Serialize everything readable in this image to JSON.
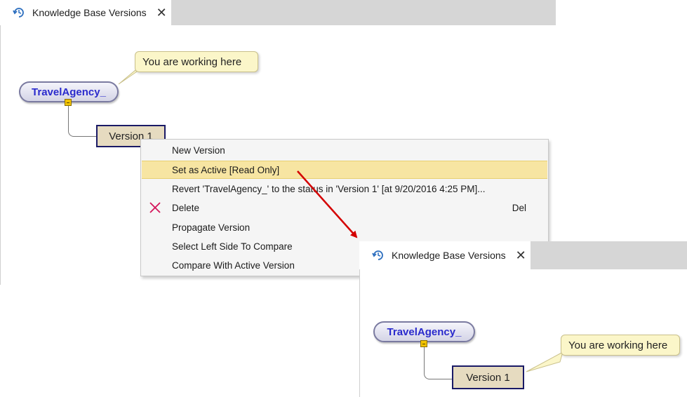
{
  "panel1": {
    "tab_title": "Knowledge Base Versions",
    "tab_close": "✕",
    "root_node": "TravelAgency_",
    "version_node": "Version 1",
    "bubble": "You are working here"
  },
  "context_menu": {
    "items": [
      {
        "label": "New Version",
        "shortcut": ""
      },
      {
        "label": "Set as Active [Read Only]",
        "shortcut": ""
      },
      {
        "label": "Revert 'TravelAgency_' to the status in 'Version 1' [at 9/20/2016 4:25 PM]...",
        "shortcut": ""
      },
      {
        "label": "Delete",
        "shortcut": "Del"
      },
      {
        "label": "Propagate Version",
        "shortcut": ""
      },
      {
        "label": "Select Left Side To Compare",
        "shortcut": ""
      },
      {
        "label": "Compare With Active Version",
        "shortcut": ""
      }
    ],
    "highlighted_index": 1
  },
  "panel2": {
    "tab_title": "Knowledge Base Versions",
    "tab_close": "✕",
    "root_node": "TravelAgency_",
    "version_node": "Version 1",
    "bubble": "You are working here"
  },
  "icons": {
    "tab": "version-history-icon",
    "delete": "delete-x-icon",
    "arrow": "annotation-arrow"
  },
  "colors": {
    "highlight": "#f7e5a2",
    "arrow": "#d40000",
    "delete_icon": "#d4145a",
    "root_text": "#2a2acc",
    "bubble": "#fbf6c9"
  }
}
